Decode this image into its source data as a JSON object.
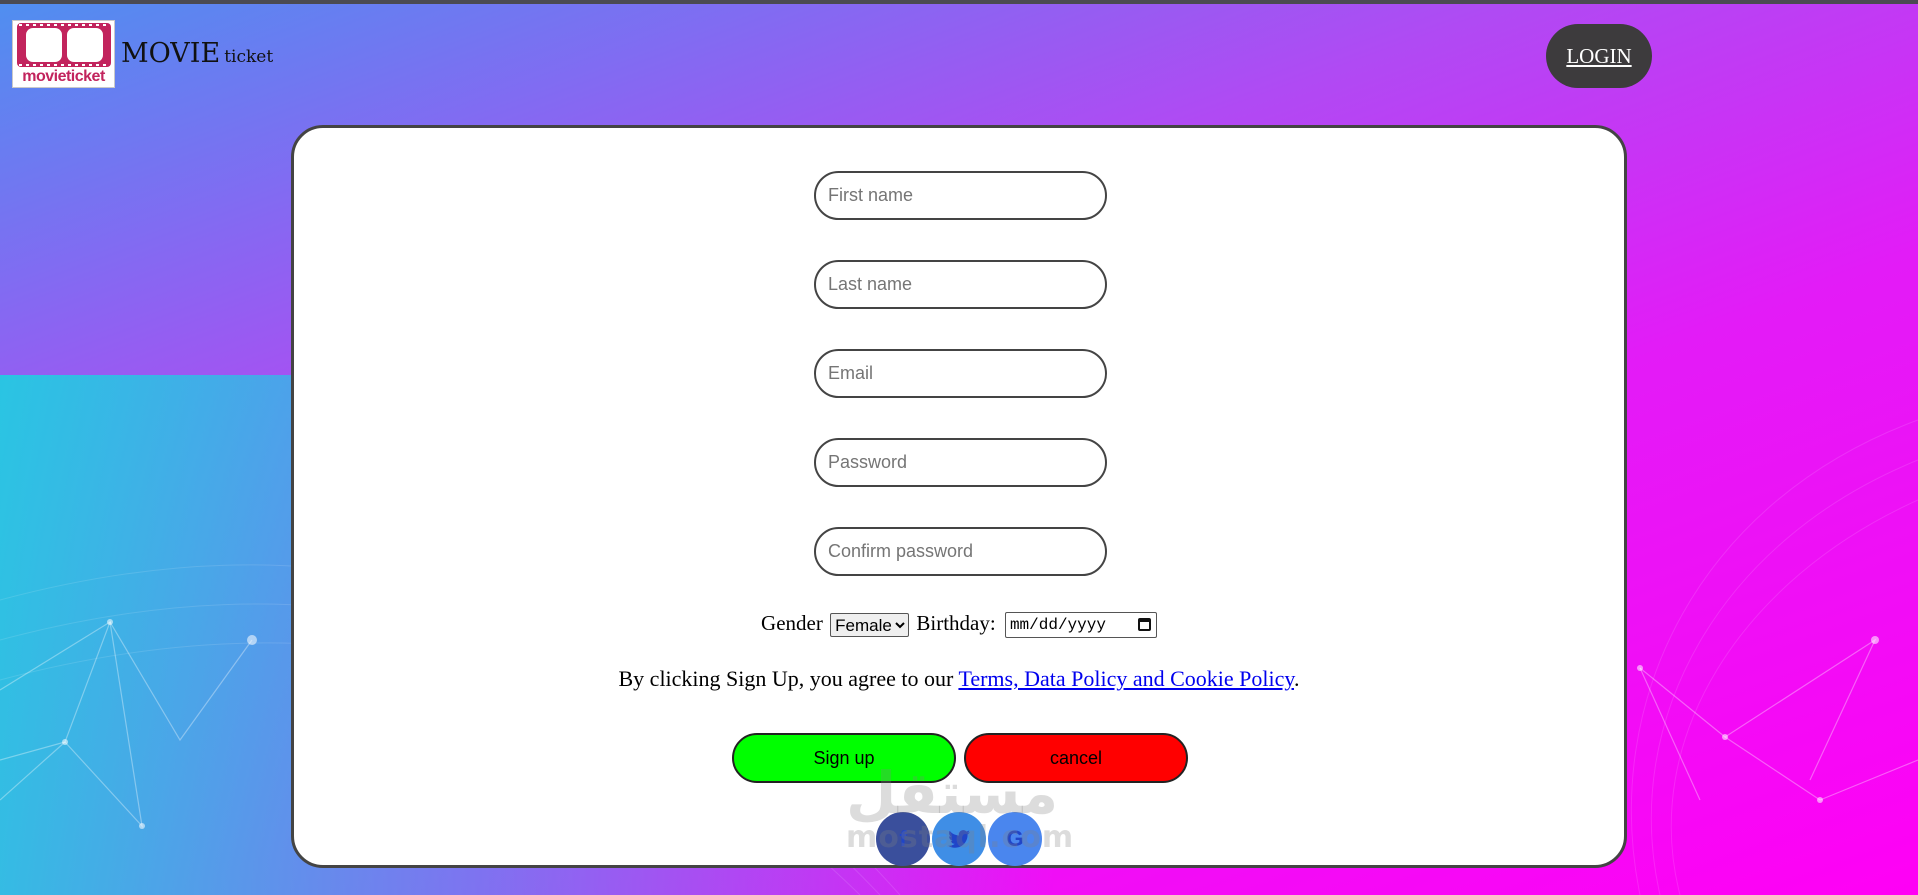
{
  "header": {
    "logo_text_1": "movie",
    "logo_text_2": "ticket",
    "brand_big": "MOVIE",
    "brand_small": "ticket",
    "login_label": "LOGIN"
  },
  "form": {
    "first_name_placeholder": "First name",
    "last_name_placeholder": "Last name",
    "email_placeholder": "Email",
    "password_placeholder": "Password",
    "confirm_password_placeholder": "Confirm password",
    "gender_label": "Gender",
    "gender_selected": "Female",
    "birthday_label": "Birthday:",
    "birthday_value": "mm/dd/yyyy",
    "terms_prefix": "By clicking Sign Up, you agree to our ",
    "terms_link": "Terms, Data Policy and Cookie Policy",
    "terms_suffix": ".",
    "signup_label": "Sign up",
    "cancel_label": "cancel"
  },
  "social": {
    "facebook_glyph": "f",
    "twitter_glyph": "🐦",
    "google_glyph": "G"
  },
  "watermark": {
    "arabic": "مستقل",
    "latin": "mostaql.com"
  },
  "colors": {
    "signup": "#00ff00",
    "cancel": "#ff0000",
    "login_bg": "#3d3b3d",
    "card_border": "#444444"
  }
}
